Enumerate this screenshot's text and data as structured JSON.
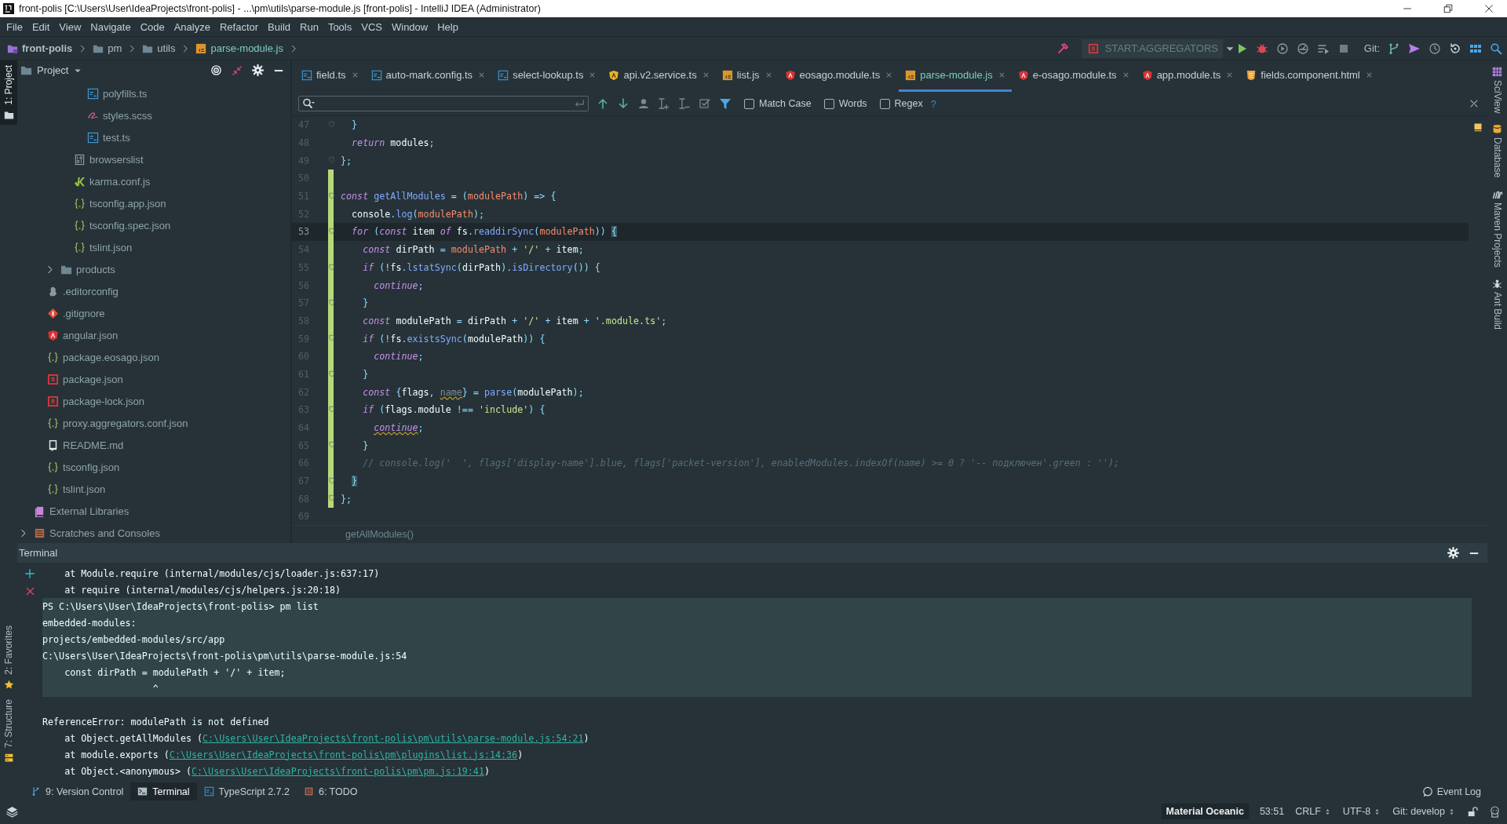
{
  "window": {
    "title": "front-polis [C:\\Users\\User\\IdeaProjects\\front-polis] - ...\\pm\\utils\\parse-module.js [front-polis] - IntelliJ IDEA (Administrator)"
  },
  "menu": [
    "File",
    "Edit",
    "View",
    "Navigate",
    "Code",
    "Analyze",
    "Refactor",
    "Build",
    "Run",
    "Tools",
    "VCS",
    "Window",
    "Help"
  ],
  "breadcrumbs": [
    {
      "label": "front-polis",
      "kind": "project"
    },
    {
      "label": "pm",
      "kind": "folder"
    },
    {
      "label": "utils",
      "kind": "folder"
    },
    {
      "label": "parse-module.js",
      "kind": "js"
    }
  ],
  "toolbar": {
    "run_config": "START:AGGREGATORS",
    "git_label": "Git:"
  },
  "left_tool_windows": [
    {
      "label": "1: Project",
      "selected": true
    },
    {
      "label": "2: Favorites",
      "selected": false
    },
    {
      "label": "7: Structure",
      "selected": false
    }
  ],
  "right_tool_windows": [
    "SciView",
    "Database",
    "Maven Projects",
    "Ant Build"
  ],
  "project_panel": {
    "title": "Project",
    "tree": [
      {
        "children": [
          {
            "children": [
              {
                "children": [
                  {
                    "children": [
                      {
                        "label": "polyfills.ts",
                        "kind": "ts"
                      },
                      {
                        "label": "styles.scss",
                        "kind": "scss"
                      },
                      {
                        "label": "test.ts",
                        "kind": "ts"
                      }
                    ]
                  },
                  {
                    "label": "browserslist",
                    "kind": "binary"
                  },
                  {
                    "label": "karma.conf.js",
                    "kind": "karma"
                  },
                  {
                    "label": "tsconfig.app.json",
                    "kind": "json"
                  },
                  {
                    "label": "tsconfig.spec.json",
                    "kind": "json"
                  },
                  {
                    "label": "tslint.json",
                    "kind": "json"
                  }
                ]
              },
              {
                "label": "products",
                "kind": "folder",
                "expanded": false
              }
            ]
          },
          {
            "label": ".editorconfig",
            "kind": "editorconfig"
          },
          {
            "label": ".gitignore",
            "kind": "git"
          },
          {
            "label": "angular.json",
            "kind": "angular"
          },
          {
            "label": "package.eosago.json",
            "kind": "json"
          },
          {
            "label": "package.json",
            "kind": "npm"
          },
          {
            "label": "package-lock.json",
            "kind": "npm"
          },
          {
            "label": "proxy.aggregators.conf.json",
            "kind": "json"
          },
          {
            "label": "README.md",
            "kind": "readme"
          },
          {
            "label": "tsconfig.json",
            "kind": "json"
          },
          {
            "label": "tslint.json",
            "kind": "json"
          }
        ]
      },
      {
        "label": "External Libraries",
        "kind": "library"
      },
      {
        "label": "Scratches and Consoles",
        "kind": "scratches",
        "expanded": false
      }
    ]
  },
  "tabs": [
    {
      "label": "field.ts",
      "kind": "ts",
      "selected": false
    },
    {
      "label": "auto-mark.config.ts",
      "kind": "ts",
      "selected": false
    },
    {
      "label": "select-lookup.ts",
      "kind": "ts",
      "selected": false
    },
    {
      "label": "api.v2.service.ts",
      "kind": "angular-service",
      "selected": false
    },
    {
      "label": "list.js",
      "kind": "js",
      "selected": false
    },
    {
      "label": "eosago.module.ts",
      "kind": "angular",
      "selected": false
    },
    {
      "label": "parse-module.js",
      "kind": "js",
      "selected": true
    },
    {
      "label": "e-osago.module.ts",
      "kind": "angular",
      "selected": false
    },
    {
      "label": "app.module.ts",
      "kind": "angular",
      "selected": false
    },
    {
      "label": "fields.component.html",
      "kind": "html",
      "selected": false
    }
  ],
  "find_bar": {
    "options": [
      {
        "label": "Match Case",
        "checked": false
      },
      {
        "label": "Words",
        "checked": false
      },
      {
        "label": "Regex",
        "checked": false
      }
    ],
    "help": "?"
  },
  "editor": {
    "breadcrumb": "getAllModules()",
    "lines": [
      {
        "number": "47",
        "fold": true,
        "changed": false,
        "tokens": [
          {
            "text": "  }",
            "kind": "punct"
          }
        ]
      },
      {
        "number": "48",
        "fold": false,
        "changed": false,
        "tokens": [
          {
            "text": "  return",
            "kind": "keyword"
          },
          {
            "text": " modules",
            "kind": "plain"
          },
          {
            "text": ";",
            "kind": "punct"
          }
        ]
      },
      {
        "number": "49",
        "fold": true,
        "changed": false,
        "tokens": [
          {
            "text": "};",
            "kind": "punct"
          }
        ]
      },
      {
        "number": "50",
        "fold": false,
        "changed": true
      },
      {
        "number": "51",
        "fold": true,
        "changed": true,
        "tokens": [
          {
            "text": "const",
            "kind": "keyword"
          },
          {
            "text": " getAllModules",
            "kind": "function"
          },
          {
            "text": " = (",
            "kind": "punct"
          },
          {
            "text": "modulePath",
            "kind": "param"
          },
          {
            "text": ") => {",
            "kind": "punct"
          }
        ]
      },
      {
        "number": "52",
        "fold": false,
        "changed": true,
        "tokens": [
          {
            "text": "  console",
            "kind": "plain"
          },
          {
            "text": ".",
            "kind": "punct"
          },
          {
            "text": "log",
            "kind": "function"
          },
          {
            "text": "(",
            "kind": "punct"
          },
          {
            "text": "modulePath",
            "kind": "param"
          },
          {
            "text": ");",
            "kind": "punct"
          }
        ]
      },
      {
        "number": "53",
        "fold": true,
        "changed": true,
        "current": true,
        "tokens": [
          {
            "text": "  for",
            "kind": "keyword"
          },
          {
            "text": " (",
            "kind": "punct"
          },
          {
            "text": "const",
            "kind": "keyword"
          },
          {
            "text": " item ",
            "kind": "plain"
          },
          {
            "text": "of",
            "kind": "keyword"
          },
          {
            "text": " fs",
            "kind": "plain"
          },
          {
            "text": ".",
            "kind": "punct"
          },
          {
            "text": "readdirSync",
            "kind": "function"
          },
          {
            "text": "(",
            "kind": "punct"
          },
          {
            "text": "modulePath",
            "kind": "param"
          },
          {
            "text": ")) ",
            "kind": "punct"
          },
          {
            "text": "{",
            "kind": "punct",
            "matched": true
          }
        ]
      },
      {
        "number": "54",
        "fold": false,
        "changed": true,
        "tokens": [
          {
            "text": "    const",
            "kind": "keyword"
          },
          {
            "text": " dirPath ",
            "kind": "plain"
          },
          {
            "text": "= ",
            "kind": "punct"
          },
          {
            "text": "modulePath",
            "kind": "param"
          },
          {
            "text": " + ",
            "kind": "punct"
          },
          {
            "text": "'/'",
            "kind": "string"
          },
          {
            "text": " + ",
            "kind": "punct"
          },
          {
            "text": "item",
            "kind": "plain"
          },
          {
            "text": ";",
            "kind": "punct"
          }
        ]
      },
      {
        "number": "55",
        "fold": true,
        "changed": true,
        "tokens": [
          {
            "text": "    if",
            "kind": "keyword"
          },
          {
            "text": " (!",
            "kind": "punct"
          },
          {
            "text": "fs",
            "kind": "plain"
          },
          {
            "text": ".",
            "kind": "punct"
          },
          {
            "text": "lstatSync",
            "kind": "function"
          },
          {
            "text": "(",
            "kind": "punct"
          },
          {
            "text": "dirPath",
            "kind": "plain"
          },
          {
            "text": ").",
            "kind": "punct"
          },
          {
            "text": "isDirectory",
            "kind": "function"
          },
          {
            "text": "()) {",
            "kind": "punct"
          }
        ]
      },
      {
        "number": "56",
        "fold": false,
        "changed": true,
        "tokens": [
          {
            "text": "      continue",
            "kind": "keyword"
          },
          {
            "text": ";",
            "kind": "punct"
          }
        ]
      },
      {
        "number": "57",
        "fold": true,
        "changed": true,
        "tokens": [
          {
            "text": "    }",
            "kind": "punct"
          }
        ]
      },
      {
        "number": "58",
        "fold": false,
        "changed": true,
        "tokens": [
          {
            "text": "    const",
            "kind": "keyword"
          },
          {
            "text": " modulePath ",
            "kind": "plain"
          },
          {
            "text": "= ",
            "kind": "punct"
          },
          {
            "text": "dirPath",
            "kind": "plain"
          },
          {
            "text": " + ",
            "kind": "punct"
          },
          {
            "text": "'/'",
            "kind": "string"
          },
          {
            "text": " + ",
            "kind": "punct"
          },
          {
            "text": "item",
            "kind": "plain"
          },
          {
            "text": " + ",
            "kind": "punct"
          },
          {
            "text": "'.module.ts'",
            "kind": "string"
          },
          {
            "text": ";",
            "kind": "punct"
          }
        ]
      },
      {
        "number": "59",
        "fold": true,
        "changed": true,
        "tokens": [
          {
            "text": "    if",
            "kind": "keyword"
          },
          {
            "text": " (!",
            "kind": "punct"
          },
          {
            "text": "fs",
            "kind": "plain"
          },
          {
            "text": ".",
            "kind": "punct"
          },
          {
            "text": "existsSync",
            "kind": "function"
          },
          {
            "text": "(",
            "kind": "punct"
          },
          {
            "text": "modulePath",
            "kind": "plain"
          },
          {
            "text": ")) {",
            "kind": "punct"
          }
        ]
      },
      {
        "number": "60",
        "fold": false,
        "changed": true,
        "tokens": [
          {
            "text": "      continue",
            "kind": "keyword"
          },
          {
            "text": ";",
            "kind": "punct"
          }
        ]
      },
      {
        "number": "61",
        "fold": true,
        "changed": true,
        "tokens": [
          {
            "text": "    }",
            "kind": "punct"
          }
        ]
      },
      {
        "number": "62",
        "fold": false,
        "changed": true,
        "tokens": [
          {
            "text": "    const",
            "kind": "keyword"
          },
          {
            "text": " {",
            "kind": "punct"
          },
          {
            "text": "flags",
            "kind": "plain"
          },
          {
            "text": ", ",
            "kind": "punct"
          },
          {
            "text": "name",
            "kind": "unused",
            "warning": true
          },
          {
            "text": "} = ",
            "kind": "punct"
          },
          {
            "text": "parse",
            "kind": "function"
          },
          {
            "text": "(",
            "kind": "punct"
          },
          {
            "text": "modulePath",
            "kind": "plain"
          },
          {
            "text": ");",
            "kind": "punct"
          }
        ]
      },
      {
        "number": "63",
        "fold": true,
        "changed": true,
        "tokens": [
          {
            "text": "    if",
            "kind": "keyword"
          },
          {
            "text": " (",
            "kind": "punct"
          },
          {
            "text": "flags",
            "kind": "plain"
          },
          {
            "text": ".",
            "kind": "punct"
          },
          {
            "text": "module",
            "kind": "plain"
          },
          {
            "text": " !== ",
            "kind": "punct"
          },
          {
            "text": "'include'",
            "kind": "string"
          },
          {
            "text": ") {",
            "kind": "punct"
          }
        ]
      },
      {
        "number": "64",
        "fold": false,
        "changed": true,
        "tokens": [
          {
            "text": "      continue",
            "kind": "keyword",
            "warning": true
          },
          {
            "text": ";",
            "kind": "punct"
          }
        ]
      },
      {
        "number": "65",
        "fold": true,
        "changed": true,
        "tokens": [
          {
            "text": "    }",
            "kind": "punct"
          }
        ]
      },
      {
        "number": "66",
        "fold": false,
        "changed": true,
        "tokens": [
          {
            "text": "    // console.log('  ', flags['display-name'].blue, flags['packet-version'], enabledModules.indexOf(name) >= 0 ? '-- подключен'.green : '');",
            "kind": "comment"
          }
        ]
      },
      {
        "number": "67",
        "fold": true,
        "changed": true,
        "tokens": [
          {
            "text": "  }",
            "kind": "punct",
            "matched": true
          }
        ]
      },
      {
        "number": "68",
        "fold": true,
        "changed": true,
        "tokens": [
          {
            "text": "};",
            "kind": "punct"
          }
        ]
      },
      {
        "number": "69",
        "fold": false,
        "changed": false
      }
    ]
  },
  "terminal": {
    "title": "Terminal",
    "lines": [
      {
        "text": "    at Module.require (internal/modules/cjs/loader.js:637:17)",
        "highlighted": false
      },
      {
        "text": "    at require (internal/modules/cjs/helpers.js:20:18)",
        "highlighted": false
      },
      {
        "text": "PS C:\\Users\\User\\IdeaProjects\\front-polis> pm list",
        "highlighted": true
      },
      {
        "text": "embedded-modules:",
        "highlighted": true
      },
      {
        "text": "projects/embedded-modules/src/app",
        "highlighted": true
      },
      {
        "text": "C:\\Users\\User\\IdeaProjects\\front-polis\\pm\\utils\\parse-module.js:54",
        "highlighted": true
      },
      {
        "text": "    const dirPath = modulePath + '/' + item;",
        "highlighted": true
      },
      {
        "text": "                    ^",
        "highlighted": true
      },
      {
        "text": "ReferenceError: modulePath is not defined",
        "highlighted": false,
        "blank_before": true
      },
      {
        "text": "    at Object.getAllModules (",
        "link": "C:\\Users\\User\\IdeaProjects\\front-polis\\pm\\utils\\parse-module.js:54:21",
        "suffix": ")",
        "highlighted": false
      },
      {
        "text": "    at module.exports (",
        "link": "C:\\Users\\User\\IdeaProjects\\front-polis\\pm\\plugins\\list.js:14:36",
        "suffix": ")",
        "highlighted": false
      },
      {
        "text": "    at Object.<anonymous> (",
        "link": "C:\\Users\\User\\IdeaProjects\\front-polis\\pm\\pm.js:19:41",
        "suffix": ")",
        "highlighted": false
      }
    ]
  },
  "bottom_tabs": [
    {
      "label": "9: Version Control",
      "kind": "vcs",
      "selected": false
    },
    {
      "label": "Terminal",
      "kind": "terminal",
      "selected": true
    },
    {
      "label": "TypeScript 2.7.2",
      "kind": "ts",
      "selected": false
    },
    {
      "label": "6: TODO",
      "kind": "todo",
      "selected": false
    }
  ],
  "event_log": "Event Log",
  "status_bar": {
    "theme": "Material Oceanic",
    "position": "53:51",
    "line_separator": "CRLF",
    "encoding": "UTF-8",
    "branch": "Git: develop"
  }
}
